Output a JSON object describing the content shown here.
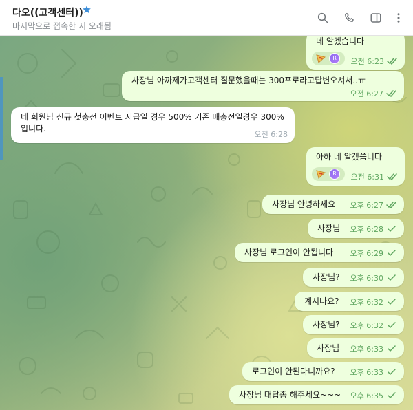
{
  "header": {
    "title": "다오((고객센터))",
    "status": "마지막으로 접속한 지 오래됨",
    "icons": [
      "star-icon",
      "search-icon",
      "phone-icon",
      "sidebar-icon",
      "more-icon"
    ]
  },
  "reaction_avatar_letter": "R",
  "messages": [
    {
      "text": "네 알겠습니다",
      "time": "오전 6:23",
      "dir": "out",
      "read": true,
      "reaction": true
    },
    {
      "text": "사장님 아까제가고객센터 질문했을때는 300프로라고답변오셔서..ㅠ",
      "time": "오전 6:27",
      "dir": "out",
      "read": true
    },
    {
      "text": "네 회원님 신규 첫충전 이벤트 지급일 경우 500% 기존 매충전일경우 300% 입니다.",
      "time": "오전 6:28",
      "dir": "in"
    },
    {
      "text": "아하 네 알겠씁니다",
      "time": "오전 6:31",
      "dir": "out",
      "read": true,
      "reaction": true
    },
    {
      "text": "사장님 안녕하세요",
      "time": "오후 6:27",
      "dir": "out",
      "read": true
    },
    {
      "text": "사장님",
      "time": "오후 6:28",
      "dir": "out",
      "read": false
    },
    {
      "text": "사장님 로그인이 안됩니다",
      "time": "오후 6:29",
      "dir": "out",
      "read": false
    },
    {
      "text": "사장님?",
      "time": "오후 6:30",
      "dir": "out",
      "read": false
    },
    {
      "text": "계시나요?",
      "time": "오후 6:32",
      "dir": "out",
      "read": false
    },
    {
      "text": "사장님?",
      "time": "오후 6:32",
      "dir": "out",
      "read": false
    },
    {
      "text": "사장님",
      "time": "오후 6:33",
      "dir": "out",
      "read": false
    },
    {
      "text": "로그인이 안된다니까요?",
      "time": "오후 6:33",
      "dir": "out",
      "read": false
    },
    {
      "text": "사장님 대답좀 해주세요~~~",
      "time": "오후 6:35",
      "dir": "out",
      "read": false
    }
  ],
  "colors": {
    "outgoing_bubble": "#eeffde",
    "incoming_bubble": "#ffffff",
    "check_green": "#5fa660",
    "accent_blue": "#3d8ed9"
  }
}
